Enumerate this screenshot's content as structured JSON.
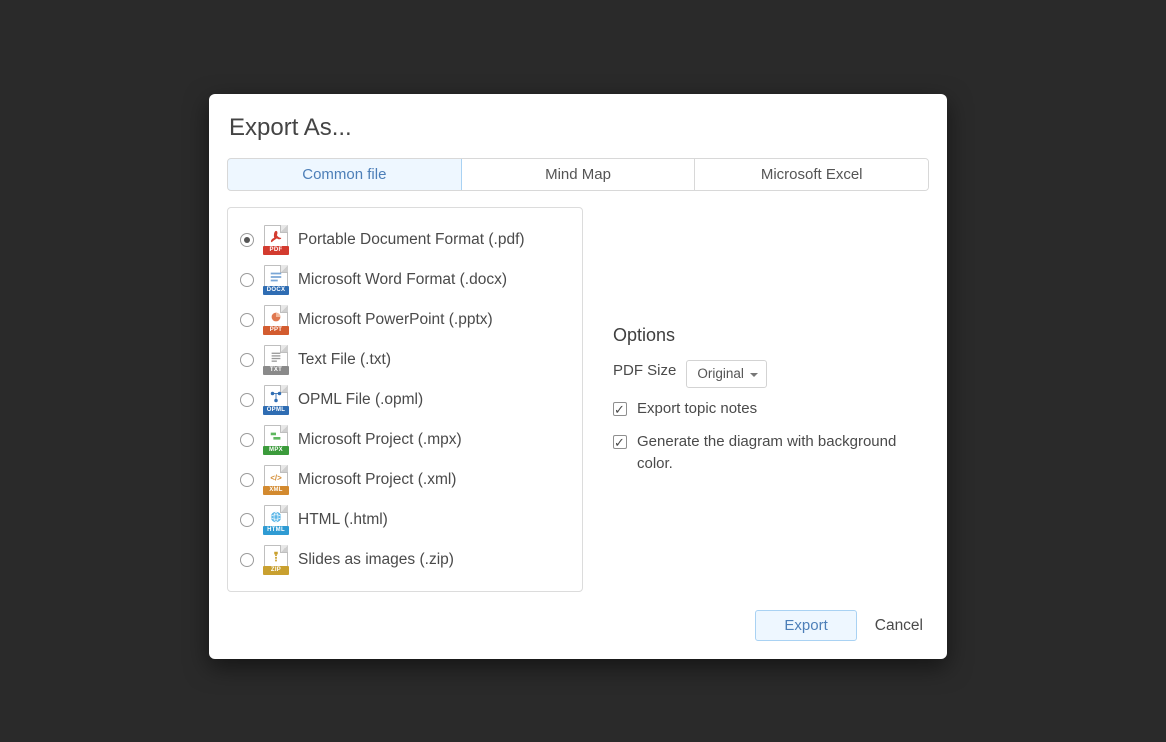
{
  "dialog": {
    "title": "Export As...",
    "tabs": [
      {
        "label": "Common file",
        "active": true
      },
      {
        "label": "Mind Map",
        "active": false
      },
      {
        "label": "Microsoft Excel",
        "active": false
      }
    ]
  },
  "formats": [
    {
      "label": "Portable Document Format (.pdf)",
      "badge": "PDF",
      "badge_color": "#d33b2f",
      "icon_name": "pdf-icon",
      "selected": true
    },
    {
      "label": "Microsoft Word Format (.docx)",
      "badge": "DOCX",
      "badge_color": "#2f6db3",
      "icon_name": "docx-icon",
      "selected": false
    },
    {
      "label": "Microsoft PowerPoint (.pptx)",
      "badge": "PPT",
      "badge_color": "#d35c2f",
      "icon_name": "pptx-icon",
      "selected": false
    },
    {
      "label": "Text File (.txt)",
      "badge": "TXT",
      "badge_color": "#8a8a8a",
      "icon_name": "txt-icon",
      "selected": false
    },
    {
      "label": "OPML File (.opml)",
      "badge": "OPML",
      "badge_color": "#2f6db3",
      "icon_name": "opml-icon",
      "selected": false
    },
    {
      "label": "Microsoft Project (.mpx)",
      "badge": "MPX",
      "badge_color": "#3b9b3b",
      "icon_name": "mpx-icon",
      "selected": false
    },
    {
      "label": "Microsoft Project (.xml)",
      "badge": "XML",
      "badge_color": "#d38a2f",
      "icon_name": "xml-icon",
      "selected": false
    },
    {
      "label": "HTML (.html)",
      "badge": "HTML",
      "badge_color": "#2f9bd3",
      "icon_name": "html-icon",
      "selected": false
    },
    {
      "label": "Slides as images (.zip)",
      "badge": "ZIP",
      "badge_color": "#c9a02f",
      "icon_name": "zip-icon",
      "selected": false
    }
  ],
  "options": {
    "heading": "Options",
    "pdf_size_label": "PDF Size",
    "pdf_size_value": "Original",
    "export_notes": {
      "label": "Export topic notes",
      "checked": true
    },
    "bg_color": {
      "label": "Generate the diagram with background color.",
      "checked": true
    }
  },
  "footer": {
    "export_label": "Export",
    "cancel_label": "Cancel"
  },
  "icon_inner": {
    "pdf": {
      "svg": "<svg viewBox='0 0 16 16' width='14' height='14'><path fill='#d33b2f' d='M8 1c2 0 2 3 1 5 1.2 2 3 3 5 3 0 2-3 2-5 .5C7 11 5 12 3 14c-2-1 0-4 3-5C5 6 6 1 8 1z'/></svg>"
    },
    "docx": {
      "svg": "<svg viewBox='0 0 16 16' width='14' height='14'><rect x='2' y='3' width='12' height='2' fill='#7aa6d6'/><rect x='2' y='7' width='12' height='2' fill='#7aa6d6'/><rect x='2' y='11' width='8' height='2' fill='#7aa6d6'/></svg>"
    },
    "ppt": {
      "svg": "<svg viewBox='0 0 16 16' width='14' height='14'><circle cx='8' cy='8' r='5' fill='#e07850'/><path d='M8 3 A5 5 0 0 1 13 8 L8 8 Z' fill='#f3b89a'/></svg>"
    },
    "txt": {
      "svg": "<svg viewBox='0 0 16 16' width='14' height='14'><rect x='3' y='3' width='10' height='1.5' fill='#999'/><rect x='3' y='6' width='10' height='1.5' fill='#999'/><rect x='3' y='9' width='10' height='1.5' fill='#999'/><rect x='3' y='12' width='6' height='1.5' fill='#999'/></svg>"
    },
    "opml": {
      "svg": "<svg viewBox='0 0 16 16' width='14' height='14'><circle cx='4' cy='4' r='2' fill='#2f6db3'/><circle cx='12' cy='4' r='2' fill='#2f6db3'/><circle cx='8' cy='12' r='2' fill='#2f6db3'/><path d='M4 4 L12 4 M8 4 L8 12' stroke='#2f6db3' stroke-width='1'/></svg>"
    },
    "mpx": {
      "svg": "<svg viewBox='0 0 16 16' width='14' height='14'><rect x='2' y='3' width='6' height='3' fill='#5fb85f'/><rect x='5' y='8' width='8' height='3' fill='#5fb85f'/></svg>"
    },
    "xml": {
      "svg": "<svg viewBox='0 0 16 16' width='14' height='14'><text x='8' y='12' text-anchor='middle' font-size='9' font-weight='bold' fill='#d38a2f'>&lt;/&gt;</text></svg>"
    },
    "html": {
      "svg": "<svg viewBox='0 0 16 16' width='14' height='14'><circle cx='8' cy='8' r='6' fill='#5fb8e8'/><ellipse cx='8' cy='8' rx='6' ry='2.5' fill='none' stroke='#fff' stroke-width='0.7'/><path d='M8 2 C5 5 5 11 8 14 M8 2 C11 5 11 11 8 14' fill='none' stroke='#fff' stroke-width='0.7'/></svg>"
    },
    "zip": {
      "svg": "<svg viewBox='0 0 16 16' width='14' height='14'><rect x='6' y='2' width='4' height='3' fill='#c9a02f'/><rect x='7' y='5' width='2' height='2' fill='#c9a02f'/><rect x='7' y='8' width='2' height='2' fill='#c9a02f'/><rect x='7' y='11' width='2' height='2' fill='#c9a02f'/></svg>"
    }
  }
}
